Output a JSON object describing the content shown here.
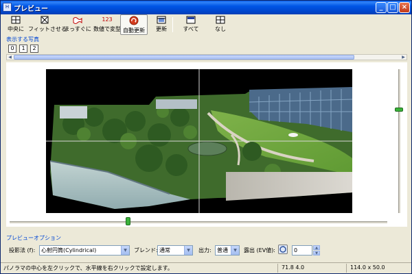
{
  "window": {
    "title": "プレビュー"
  },
  "title_buttons": {
    "minimize": "_",
    "maximize": "□",
    "close": "×"
  },
  "toolbar": {
    "center": "中央に",
    "fit": "フィットさせる",
    "straighten": "まっすぐに",
    "numeric_label": "数値で変型",
    "numeric_icon_text": "123",
    "auto_update": "自動更新",
    "update": "更新",
    "all": "すべて",
    "none": "なし"
  },
  "images_section": {
    "title": "表示する写真",
    "tabs": [
      "0",
      "1",
      "2"
    ]
  },
  "preview": {
    "horizontal_slider_level": 0.32,
    "vertical_slider_level": 0.27
  },
  "options": {
    "title": "プレビューオプション",
    "projection_label": "投影法 (f):",
    "projection_value": "心射円筒(Cylindrical)",
    "blend_label": "ブレンド:",
    "blend_value": "通常",
    "output_label": "出力:",
    "output_value": "普通",
    "exposure_label": "露出 (EV値):",
    "exposure_value": "0"
  },
  "status": {
    "message": "パノラマの中心を左クリックで、水平線を右クリックで設定します。",
    "fov": "71.8 4.0",
    "size": "114.0 x 50.0"
  },
  "colors": {
    "titlebar": "#0055e5",
    "section_title": "#0046d5",
    "slider_thumb": "#3ab13a"
  }
}
